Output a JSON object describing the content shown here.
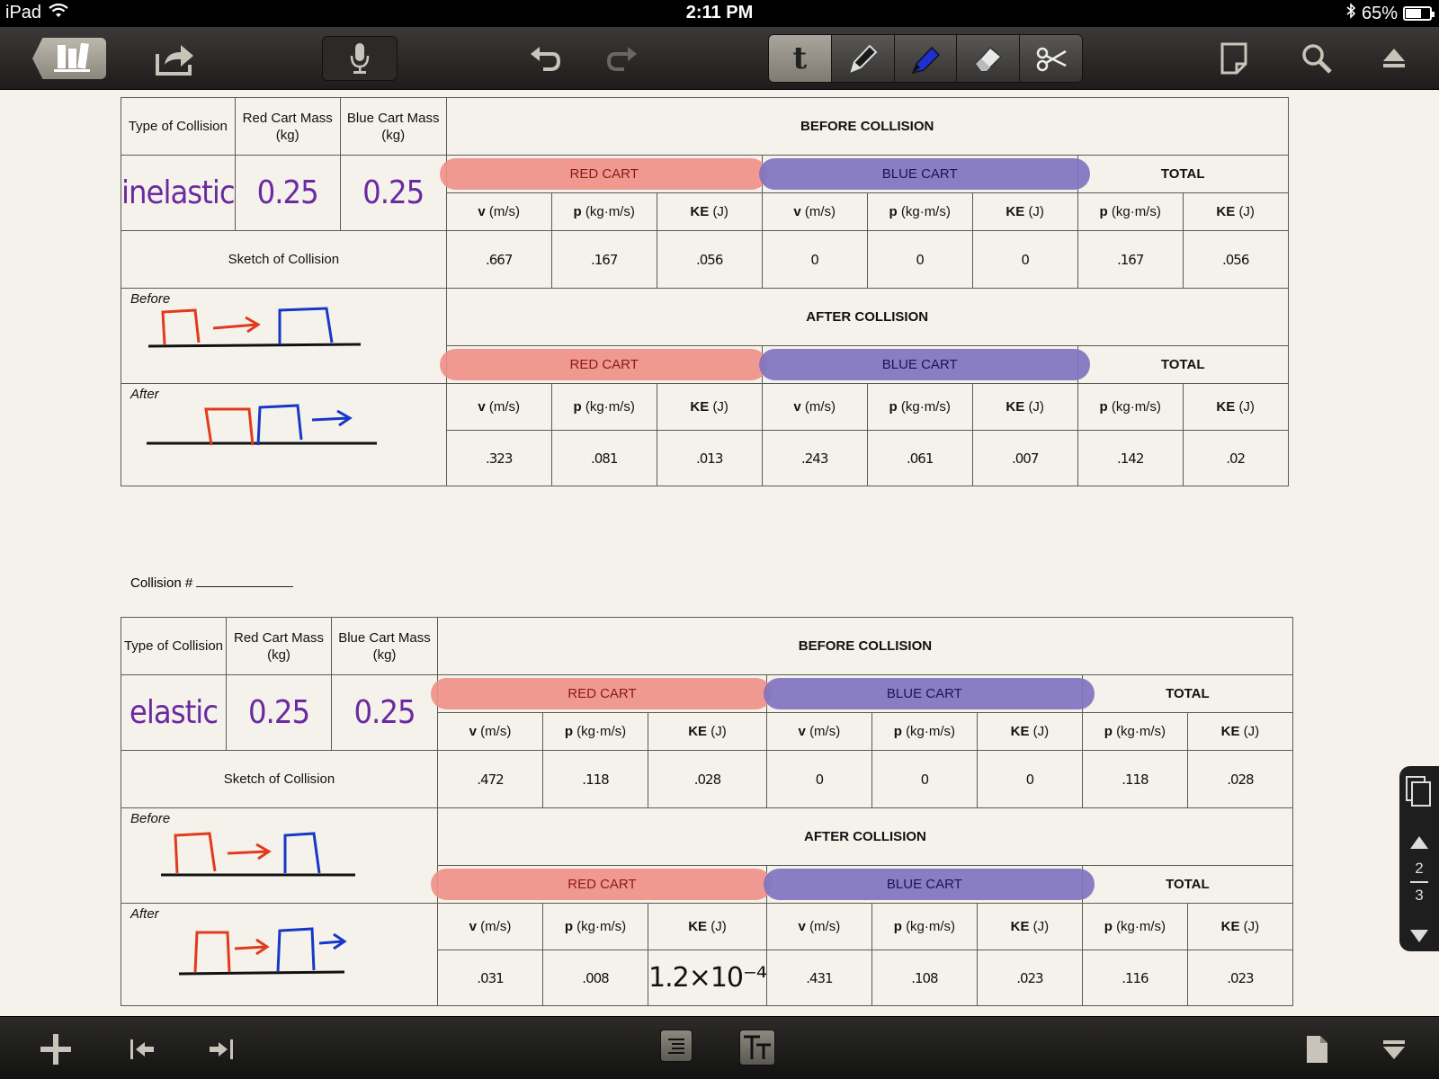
{
  "status_bar": {
    "device": "iPad",
    "time": "2:11 PM",
    "battery": "65%",
    "battery_level": 0.65
  },
  "toolbar": {
    "text_tool": "t"
  },
  "tables": [
    {
      "headers": {
        "type": "Type of Collision",
        "red_mass": "Red Cart Mass (kg)",
        "blue_mass": "Blue Cart Mass (kg)",
        "sketch": "Sketch of Collision",
        "before_caption": "Before",
        "after_caption": "After"
      },
      "type_value": "inelastic",
      "red_mass_value": "0.25",
      "blue_mass_value": "0.25",
      "before_title": "BEFORE COLLISION",
      "after_title": "AFTER COLLISION",
      "carts": {
        "red": "RED CART",
        "blue": "BLUE CART",
        "total": "TOTAL"
      },
      "before_values": [
        ".667",
        ".167",
        ".056",
        "0",
        "0",
        "0",
        ".167",
        ".056"
      ],
      "after_values": [
        ".323",
        ".081",
        ".013",
        ".243",
        ".061",
        ".007",
        ".142",
        ".02"
      ]
    },
    {
      "headers": {
        "type": "Type of Collision",
        "red_mass": "Red Cart Mass (kg)",
        "blue_mass": "Blue Cart Mass (kg)",
        "sketch": "Sketch of Collision",
        "before_caption": "Before",
        "after_caption": "After"
      },
      "type_value": "elastic",
      "red_mass_value": "0.25",
      "blue_mass_value": "0.25",
      "before_title": "BEFORE COLLISION",
      "after_title": "AFTER COLLISION",
      "carts": {
        "red": "RED CART",
        "blue": "BLUE CART",
        "total": "TOTAL"
      },
      "before_values": [
        ".472",
        ".118",
        ".028",
        "0",
        "0",
        "0",
        ".118",
        ".028"
      ],
      "after_values": [
        ".031",
        ".008",
        "1.2×10⁻⁴",
        ".431",
        ".108",
        ".023",
        ".116",
        ".023"
      ]
    }
  ],
  "units": [
    {
      "sym": "v",
      "unit": "(m/s)"
    },
    {
      "sym": "p",
      "unit": "(kg·m/s)"
    },
    {
      "sym": "KE",
      "unit": "(J)"
    },
    {
      "sym": "v",
      "unit": "(m/s)"
    },
    {
      "sym": "p",
      "unit": "(kg·m/s)"
    },
    {
      "sym": "KE",
      "unit": "(J)"
    },
    {
      "sym": "p",
      "unit": "(kg·m/s)"
    },
    {
      "sym": "KE",
      "unit": "(J)"
    }
  ],
  "collision_label": "Collision #",
  "page_nav": {
    "current": "2",
    "total": "3"
  },
  "colors": {
    "red_highlight": "#ef8f86",
    "blue_highlight": "#7f74bf",
    "purple_ink": "#6a2aa1",
    "toolbar": "#2b2a28"
  }
}
